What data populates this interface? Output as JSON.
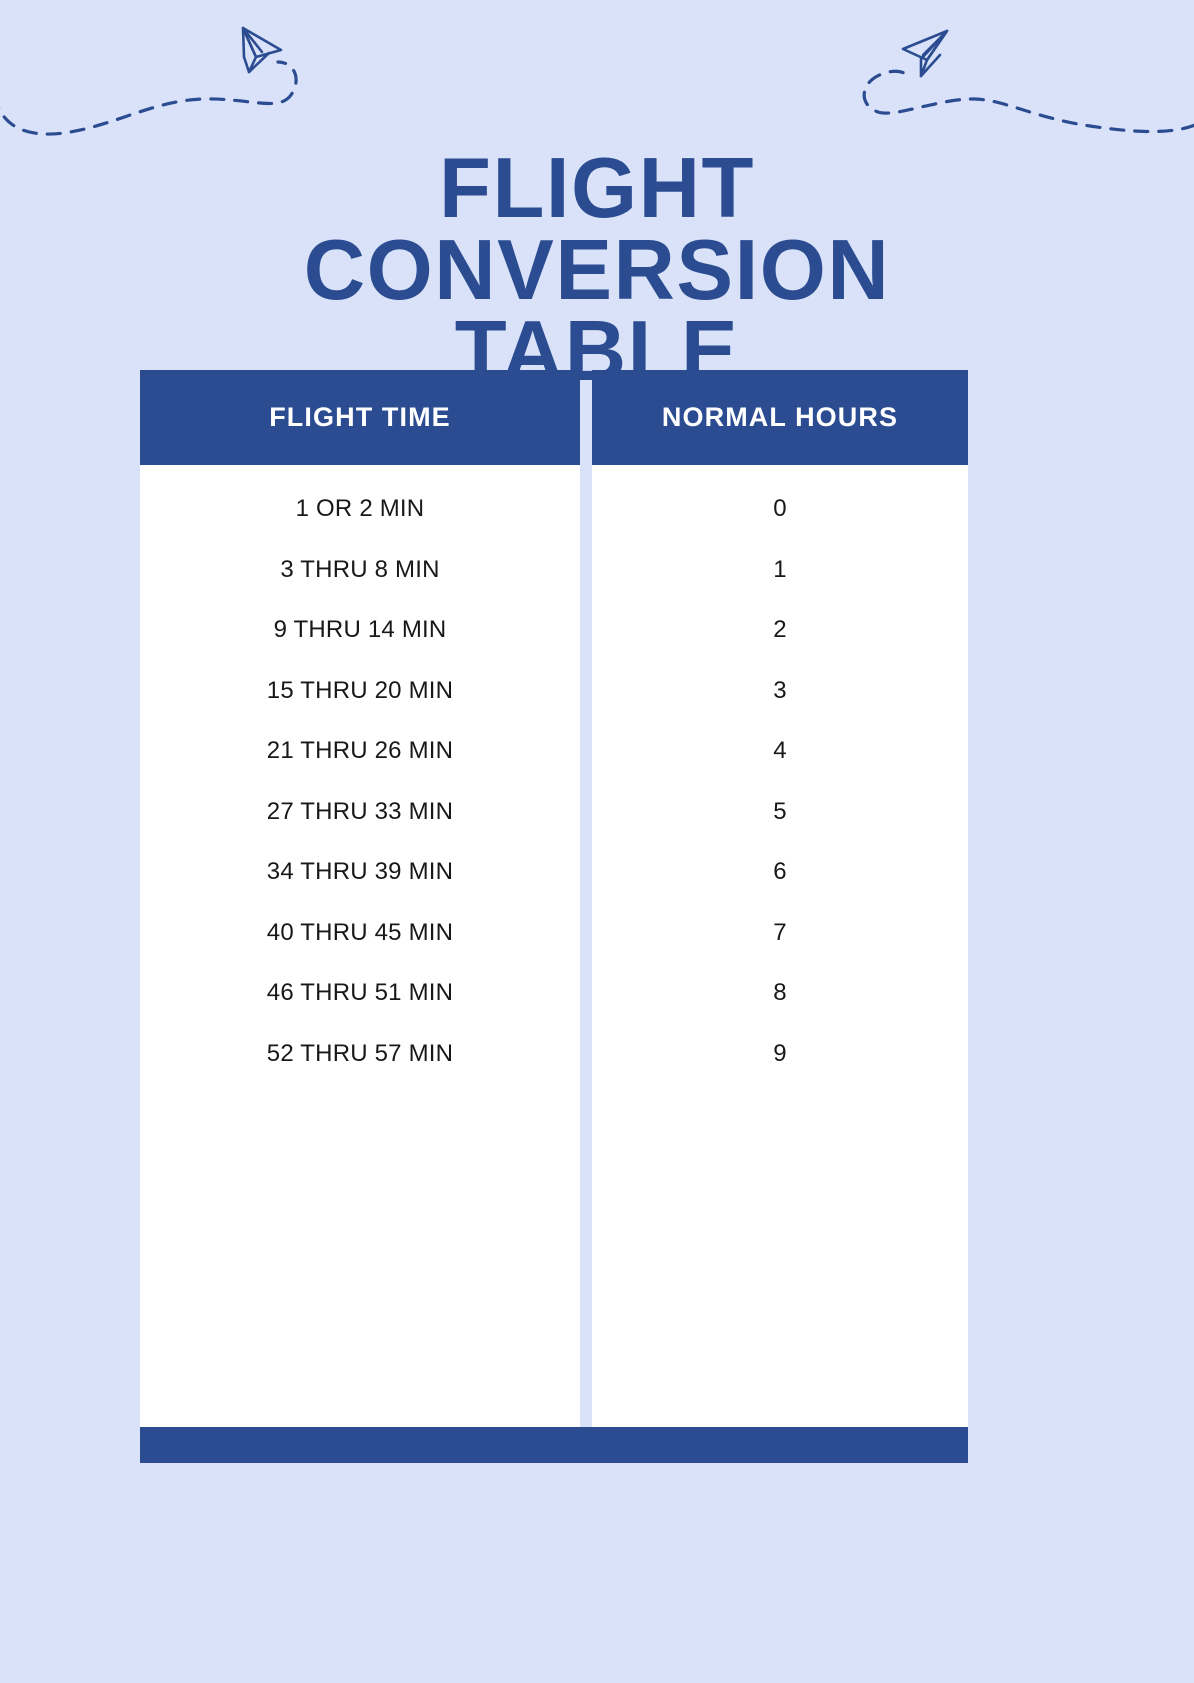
{
  "page": {
    "title": "FLIGHT CONVERSION TABLE",
    "background_color": "#d9e2f8",
    "accent_color": "#2b4c91",
    "surface_color": "#ffffff",
    "text_color": "#18181a"
  },
  "decorations": [
    {
      "name": "paper-plane-left",
      "icon": "paper-plane-icon",
      "trail": "dashed-curve"
    },
    {
      "name": "paper-plane-right",
      "icon": "paper-plane-icon",
      "trail": "dashed-curve"
    }
  ],
  "table": {
    "columns": [
      {
        "key": "flight_time",
        "header": "FLIGHT TIME"
      },
      {
        "key": "normal_hours",
        "header": "NORMAL HOURS"
      }
    ],
    "rows": [
      {
        "flight_time": "1 OR 2 MIN",
        "normal_hours": "0"
      },
      {
        "flight_time": "3 THRU 8 MIN",
        "normal_hours": "1"
      },
      {
        "flight_time": "9 THRU 14 MIN",
        "normal_hours": "2"
      },
      {
        "flight_time": "15 THRU 20 MIN",
        "normal_hours": "3"
      },
      {
        "flight_time": "21 THRU 26 MIN",
        "normal_hours": "4"
      },
      {
        "flight_time": "27 THRU 33 MIN",
        "normal_hours": "5"
      },
      {
        "flight_time": "34 THRU 39 MIN",
        "normal_hours": "6"
      },
      {
        "flight_time": "40 THRU 45 MIN",
        "normal_hours": "7"
      },
      {
        "flight_time": "46 THRU 51 MIN",
        "normal_hours": "8"
      },
      {
        "flight_time": "52 THRU 57 MIN",
        "normal_hours": "9"
      }
    ]
  }
}
